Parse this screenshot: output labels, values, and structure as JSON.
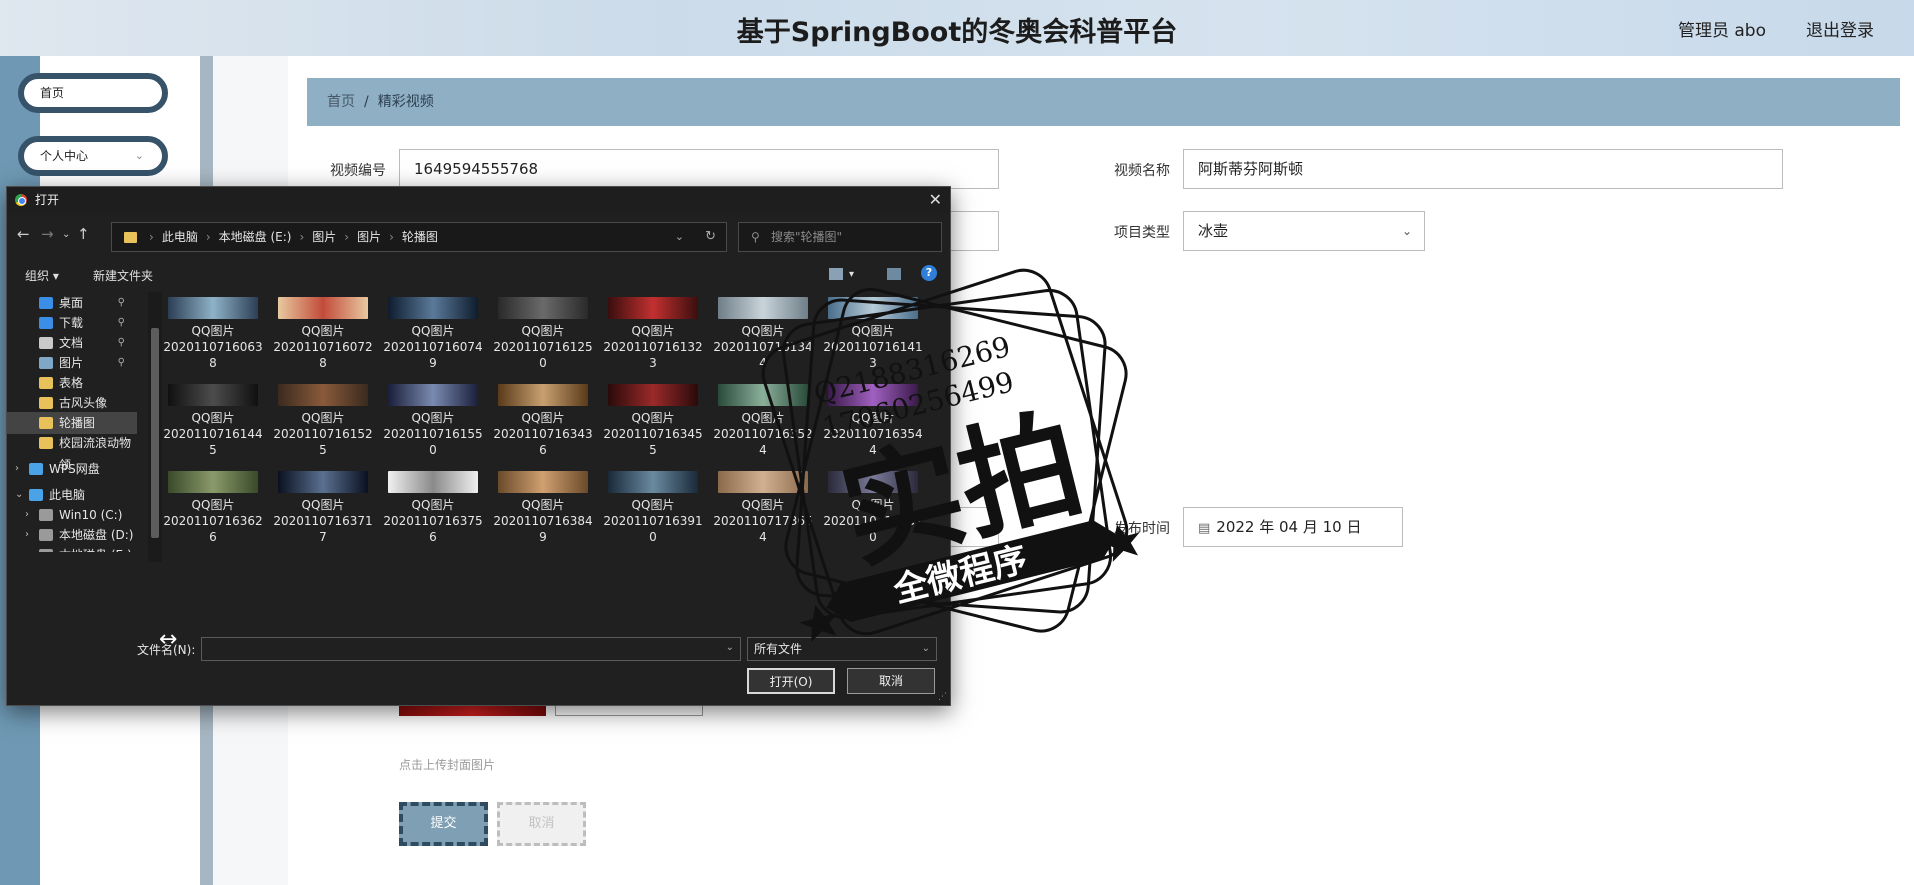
{
  "header": {
    "title": "基于SpringBoot的冬奥会科普平台",
    "admin": "管理员 abo",
    "logout": "退出登录"
  },
  "sidebar": {
    "items": [
      {
        "label": "首页"
      },
      {
        "label": "个人中心",
        "chevron": "⌄"
      }
    ]
  },
  "breadcrumb": {
    "home": "首页",
    "sep": "/",
    "current": "精彩视频"
  },
  "form": {
    "video_id_label": "视频编号",
    "video_id_value": "1649594555768",
    "video_name_label": "视频名称",
    "video_name_value": "阿斯蒂芬阿斯顿",
    "project_type_label": "项目类型",
    "project_type_value": "冰壶",
    "publish_time_label": "发布时间",
    "publish_time_value": "2022 年 04 月 10 日",
    "upload_hint": "点击上传封面图片",
    "submit": "提交",
    "cancel": "取消"
  },
  "dialog": {
    "title": "打开",
    "close": "✕",
    "address": [
      "此电脑",
      "本地磁盘 (E:)",
      "图片",
      "图片",
      "轮播图"
    ],
    "search_placeholder": "搜索\"轮播图\"",
    "organize": "组织 ▾",
    "new_folder": "新建文件夹",
    "tree": [
      {
        "label": "桌面",
        "icon": "desktop-icon",
        "color": "#3a8ee6",
        "pin": true
      },
      {
        "label": "下载",
        "icon": "download-icon",
        "color": "#3a8ee6",
        "pin": true
      },
      {
        "label": "文档",
        "icon": "document-icon",
        "color": "#c9c9c9",
        "pin": true
      },
      {
        "label": "图片",
        "icon": "picture-icon",
        "color": "#7fa7c8",
        "pin": true
      },
      {
        "label": "表格",
        "icon": "folder-icon",
        "color": "#e8c15a",
        "pin": false
      },
      {
        "label": "古风头像",
        "icon": "folder-icon",
        "color": "#e8c15a",
        "pin": false
      },
      {
        "label": "轮播图",
        "icon": "folder-icon",
        "color": "#e8c15a",
        "pin": false,
        "selected": true
      },
      {
        "label": "校园流浪动物领",
        "icon": "folder-icon",
        "color": "#e8c15a",
        "pin": false
      },
      {
        "label": "WPS网盘",
        "icon": "cloud-icon",
        "color": "#4aa3e6",
        "pin": false,
        "twist": "›"
      },
      {
        "label": "此电脑",
        "icon": "computer-icon",
        "color": "#4aa3e6",
        "pin": false,
        "twist": "⌄"
      },
      {
        "label": "Win10 (C:)",
        "icon": "drive-icon",
        "color": "#9a9a9a",
        "pin": false,
        "twist": "›"
      },
      {
        "label": "本地磁盘 (D:)",
        "icon": "drive-icon",
        "color": "#9a9a9a",
        "pin": false,
        "twist": "›"
      },
      {
        "label": "本地磁盘 (E:)",
        "icon": "drive-icon",
        "color": "#9a9a9a",
        "pin": false,
        "twist": "›"
      }
    ],
    "files": [
      {
        "name": "QQ图片",
        "num": "20201107160638",
        "colors": [
          "#2c3e55",
          "#8eb2c8"
        ]
      },
      {
        "name": "QQ图片",
        "num": "20201107160728",
        "colors": [
          "#e8c9a0",
          "#c24b3a"
        ]
      },
      {
        "name": "QQ图片",
        "num": "20201107160749",
        "colors": [
          "#0f1c2e",
          "#5a7a9a"
        ]
      },
      {
        "name": "QQ图片",
        "num": "20201107161250",
        "colors": [
          "#2a2a2a",
          "#6a6a6a"
        ]
      },
      {
        "name": "QQ图片",
        "num": "20201107161323",
        "colors": [
          "#3a0e0e",
          "#c23030"
        ]
      },
      {
        "name": "QQ图片",
        "num": "20201107161344",
        "colors": [
          "#6f7e88",
          "#c9d4da"
        ]
      },
      {
        "name": "QQ图片",
        "num": "20201107161413",
        "colors": [
          "#4a6e8c",
          "#b7cbd8"
        ]
      },
      {
        "name": "QQ图片",
        "num": "20201107161445",
        "colors": [
          "#101010",
          "#4c4c4c"
        ]
      },
      {
        "name": "QQ图片",
        "num": "20201107161525",
        "colors": [
          "#3a2a1e",
          "#8a5a3a"
        ]
      },
      {
        "name": "QQ图片",
        "num": "20201107161550",
        "colors": [
          "#1a1f3a",
          "#7a8ab0"
        ]
      },
      {
        "name": "QQ图片",
        "num": "20201107163436",
        "colors": [
          "#5a3a1a",
          "#c8a070"
        ]
      },
      {
        "name": "QQ图片",
        "num": "20201107163455",
        "colors": [
          "#2a0a0a",
          "#9a2a2a"
        ]
      },
      {
        "name": "QQ图片",
        "num": "20201107163524",
        "colors": [
          "#2a4a3a",
          "#8ab09a"
        ]
      },
      {
        "name": "QQ图片",
        "num": "20201107163544",
        "colors": [
          "#3a1a4a",
          "#a060c0"
        ]
      },
      {
        "name": "QQ图片",
        "num": "20201107163626",
        "colors": [
          "#3a4a2a",
          "#8a9a6a"
        ]
      },
      {
        "name": "QQ图片",
        "num": "20201107163717",
        "colors": [
          "#0a1020",
          "#5a7090"
        ]
      },
      {
        "name": "QQ图片",
        "num": "20201107163756",
        "colors": [
          "#f0f0f0",
          "#8a8a8a"
        ]
      },
      {
        "name": "QQ图片",
        "num": "20201107163849",
        "colors": [
          "#6a4a2a",
          "#d0a070"
        ]
      },
      {
        "name": "QQ图片",
        "num": "20201107163910",
        "colors": [
          "#1a2a3a",
          "#6a8aa0"
        ]
      },
      {
        "name": "QQ图片",
        "num": "20201107173654",
        "colors": [
          "#8a6a4a",
          "#d0b090"
        ]
      },
      {
        "name": "QQ图片",
        "num": "20201107173810",
        "colors": [
          "#2a2a3a",
          "#7a7a9a"
        ]
      }
    ],
    "filename_label": "文件名(N):",
    "filetype": "所有文件",
    "open_btn": "打开(O)",
    "cancel_btn": "取消"
  },
  "watermark": {
    "line1": "Q2188316269",
    "line2": "17060256499",
    "big": "实拍",
    "banner": "全微程序"
  }
}
